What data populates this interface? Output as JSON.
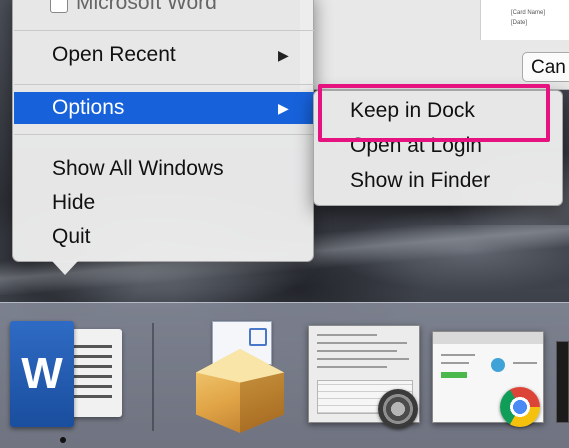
{
  "background_window": {
    "cancel_label": "Can",
    "doc_line_1": "[Card Name]",
    "doc_line_2": "[Date]"
  },
  "menu": {
    "app_title": "Microsoft Word",
    "items": [
      {
        "label": "Open Recent",
        "submenu": true
      },
      {
        "label": "Options",
        "submenu": true,
        "selected": true
      },
      {
        "label": "Show All Windows"
      },
      {
        "label": "Hide"
      },
      {
        "label": "Quit"
      }
    ],
    "submenu_arrow": "▶",
    "highlight_color": "#1762db"
  },
  "submenu": {
    "items": [
      {
        "label": "Keep in Dock",
        "callout": true
      },
      {
        "label": "Open at Login"
      },
      {
        "label": "Show in Finder"
      }
    ],
    "callout_color": "#e5127f"
  },
  "dock": {
    "word_letter": "W",
    "icons": [
      "word-icon",
      "package-installer-icon",
      "window-thumbnail-system-preferences",
      "gear-icon",
      "window-thumbnail-browser",
      "chrome-icon"
    ]
  }
}
